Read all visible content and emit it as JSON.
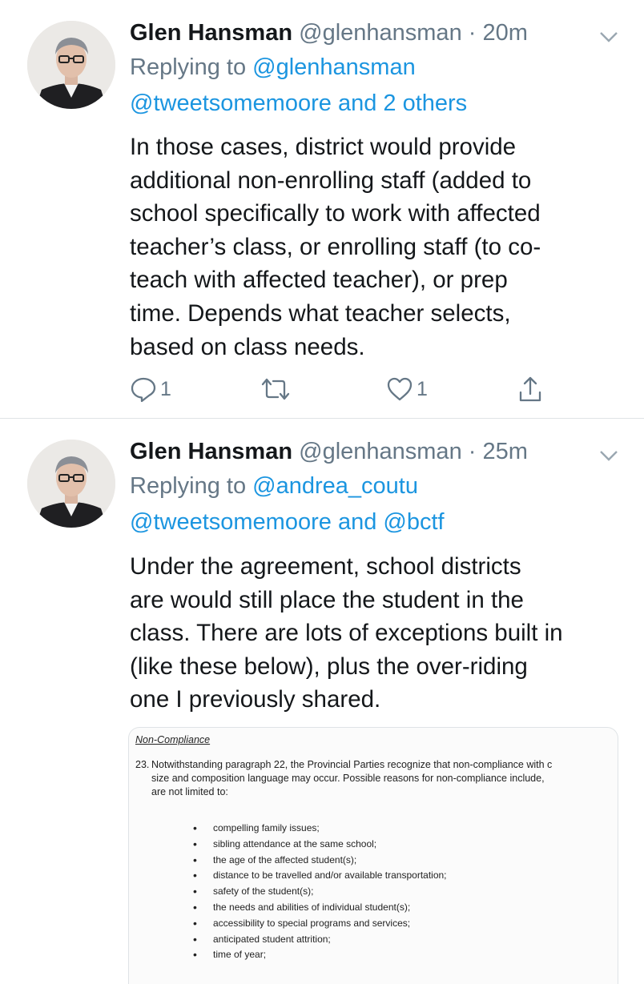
{
  "tweets": [
    {
      "name": "Glen Hansman",
      "handle": "@glenhansman",
      "separator": "·",
      "time": "20m",
      "replying_prefix": "Replying to",
      "reply_line1_mention": "@glenhansman",
      "reply_line2_mention1": "@tweetsomemoore",
      "reply_line2_conj": "and",
      "reply_line2_mention2": "2 others",
      "body_lines": [
        "In those cases, district would provide",
        "additional non-enrolling staff (added to",
        "school specifically to work with affected",
        "teacher’s class, or enrolling staff (to co-",
        "teach with affected teacher), or prep",
        "time. Depends what teacher selects,",
        "based on class needs."
      ],
      "reply_count": "1",
      "like_count": "1",
      "icons": [
        "reply-icon",
        "retweet-icon",
        "like-icon",
        "share-icon"
      ]
    },
    {
      "name": "Glen Hansman",
      "handle": "@glenhansman",
      "separator": "·",
      "time": "25m",
      "replying_prefix": "Replying to",
      "reply_line1_mention": "@andrea_coutu",
      "reply_line2_mention1": "@tweetsomemoore",
      "reply_line2_conj": "and",
      "reply_line2_mention2": "@bctf",
      "body_lines": [
        "Under the agreement, school districts",
        "are would still place the student in the",
        "class. There are lots of exceptions built in",
        "(like these below), plus the over-riding",
        "one I previously shared."
      ]
    }
  ],
  "document": {
    "title": "Non-Compliance",
    "para_number": "23.",
    "para_lines": [
      "Notwithstanding paragraph 22, the Provincial Parties recognize that non-compliance with c",
      "size and composition language may occur. Possible reasons for non-compliance include,",
      "are not limited to:"
    ],
    "bullets": [
      "compelling family issues;",
      "sibling attendance at the same school;",
      "the age of the affected student(s);",
      "distance to be travelled and/or available transportation;",
      "safety of the student(s);",
      "the needs and abilities of individual student(s);",
      "accessibility to special programs and services;",
      "anticipated student attrition;",
      "time of year;"
    ]
  },
  "colors": {
    "link": "#1b95e0",
    "secondary": "#657786",
    "text": "#14171a"
  }
}
